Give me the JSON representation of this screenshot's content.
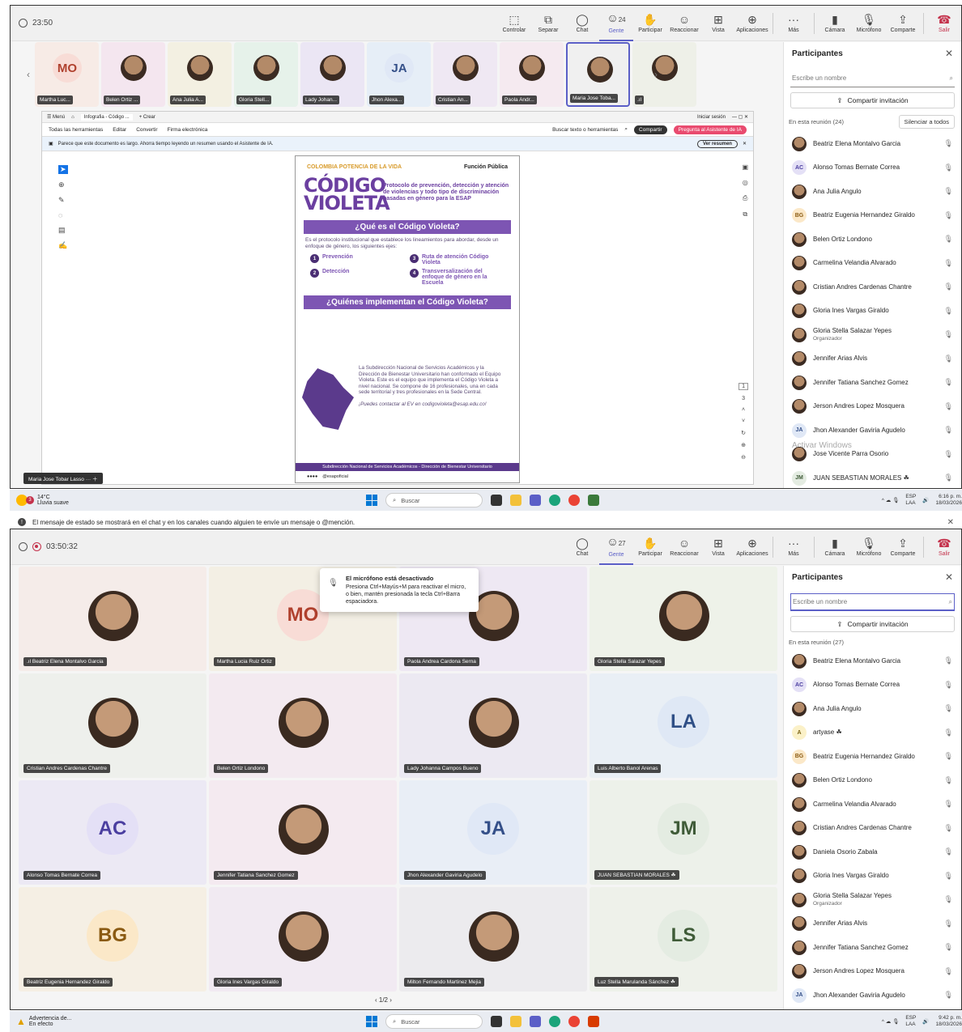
{
  "win1": {
    "timer": "23:50",
    "tools": [
      {
        "icon": "control-icon",
        "glyph": "⬚",
        "label": "Controlar"
      },
      {
        "icon": "popout-icon",
        "glyph": "⧉",
        "label": "Separar"
      },
      {
        "icon": "chat-icon",
        "glyph": "◯",
        "label": "Chat"
      },
      {
        "icon": "people-icon",
        "glyph": "☺",
        "label": "Gente",
        "count": "24"
      },
      {
        "icon": "raise-hand-icon",
        "glyph": "✋",
        "label": "Participar"
      },
      {
        "icon": "react-icon",
        "glyph": "☺",
        "label": "Reaccionar"
      },
      {
        "icon": "view-icon",
        "glyph": "⊞",
        "label": "Vista"
      },
      {
        "icon": "apps-icon",
        "glyph": "⊕",
        "label": "Aplicaciones"
      },
      {
        "icon": "more-icon",
        "glyph": "···",
        "label": "Más"
      },
      {
        "icon": "camera-icon",
        "glyph": "▮",
        "label": "Cámara"
      },
      {
        "icon": "mic-icon",
        "glyph": "🎙",
        "label": "Micrófono"
      },
      {
        "icon": "share-icon",
        "glyph": "⇪",
        "label": "Comparte"
      },
      {
        "icon": "leave-icon",
        "glyph": "☎",
        "label": "Salir"
      }
    ],
    "strip": [
      {
        "name": "Martha Luc...",
        "ini": "MO",
        "bg": "#f8dcd6",
        "fg": "#b0412e"
      },
      {
        "name": "Belen Ortiz ..."
      },
      {
        "name": "Ana Julia A..."
      },
      {
        "name": "Gloria Stell..."
      },
      {
        "name": "Lady Johan..."
      },
      {
        "name": "Jhon Alexa...",
        "ini": "JA",
        "bg": "#e0e8f6",
        "fg": "#355089"
      },
      {
        "name": "Cristian An..."
      },
      {
        "name": "Paola Andr..."
      },
      {
        "name": "Maria Jose Toba...",
        "active": true
      },
      {
        "name": ".ıl"
      }
    ],
    "pdf": {
      "tab1": "☰ Menú",
      "tab2": "Infografia - Código ...",
      "tab3": "+ Crear",
      "signin": "Iniciar sesión",
      "menu": [
        "Todas las herramientas",
        "Editar",
        "Convertir",
        "Firma electrónica"
      ],
      "search": "Buscar texto o herramientas",
      "share": "Compartir",
      "ask": "Pregunta al Asistente de IA",
      "banner": "Parece que este documento es largo. Ahorra tiempo leyendo un resumen usando el Asistente de IA.",
      "summary": "Ver resumen",
      "logo1": "COLOMBIA POTENCIA DE LA VIDA",
      "logo2": "Función Pública",
      "cv": "CÓDIGO VIOLETA",
      "protocol": "Protocolo de prevención, detección y atención de violencias y todo tipo de discriminación basadas en género para la ESAP",
      "q1": "¿Qué es el Código Violeta?",
      "p1": "Es el protocolo institucional que establece los lineamientos para abordar, desde un enfoque de género, los siguientes ejes:",
      "steps": [
        "Prevención",
        "Ruta de atención Código Violeta",
        "Detección",
        "Transversalización del enfoque de género en la Escuela"
      ],
      "q2": "¿Quiénes implementan el Código Violeta?",
      "p2": "La Subdirección Nacional de Servicios Académicos y la Dirección de Bienestar Universitario han conformado el Equipo Violeta. Este es el equipo que implementa el Código Violeta a nivel nacional. Se compone de 16 profesionales, una en cada sede territorial y tres profesionales en la Sede Central.",
      "p3": "¡Puedes contactar al EV en codigovioleta@esap.edu.co!",
      "footer": "Subdirección Nacional de Servicios Académicos - Dirección de Bienestar Universitario",
      "footer2": "@esapoficial",
      "page_num": "1",
      "page_total": "3"
    },
    "presenter": "Maria Jose Tobar Lasso",
    "panel": {
      "title": "Participantes",
      "search": "Escribe un nombre",
      "invite": "Compartir invitación",
      "meeting": "En esta reunión (24)",
      "mute": "Silenciar a todos",
      "people": [
        {
          "n": "Beatriz Elena Montalvo Garcia"
        },
        {
          "n": "Alonso Tomas Bernate Correa",
          "ini": "AC",
          "bg": "#e4e0f6",
          "fg": "#4b3fa0"
        },
        {
          "n": "Ana Julia Angulo"
        },
        {
          "n": "Beatriz Eugenia Hernandez Giraldo",
          "ini": "BG",
          "bg": "#fbe8c8",
          "fg": "#8a5a12"
        },
        {
          "n": "Belen Ortiz Londono"
        },
        {
          "n": "Carmelina Velandia Alvarado"
        },
        {
          "n": "Cristian Andres Cardenas Chantre"
        },
        {
          "n": "Gloria Ines Vargas Giraldo"
        },
        {
          "n": "Gloria Stella Salazar Yepes",
          "role": "Organizador"
        },
        {
          "n": "Jennifer Arias Alvis"
        },
        {
          "n": "Jennifer Tatiana Sanchez Gomez"
        },
        {
          "n": "Jerson Andres Lopez Mosquera"
        },
        {
          "n": "Jhon Alexander Gaviria Agudelo",
          "ini": "JA",
          "bg": "#e0e8f6",
          "fg": "#355089"
        },
        {
          "n": "Jose Vicente Parra Osorio"
        },
        {
          "n": "JUAN SEBASTIAN MORALES ☘",
          "ini": "JM",
          "bg": "#e4ece2",
          "fg": "#3f5b38"
        }
      ],
      "watermark": "Activar Windows"
    }
  },
  "taskbar1": {
    "temp": "14°C",
    "weather": "Lluvia suave",
    "search": "Buscar",
    "lang": "ESP",
    "lang2": "LAA",
    "time": "6:16 p. m.",
    "date": "18/03/2026",
    "badge": "3"
  },
  "notice": "El mensaje de estado se mostrará en el chat y en los canales cuando alguien te envíe un mensaje o @mención.",
  "win2": {
    "timer": "03:50:32",
    "tools": [
      {
        "icon": "chat-icon",
        "glyph": "◯",
        "label": "Chat"
      },
      {
        "icon": "people-icon",
        "glyph": "☺",
        "label": "Gente",
        "count": "27"
      },
      {
        "icon": "raise-hand-icon",
        "glyph": "✋",
        "label": "Participar"
      },
      {
        "icon": "react-icon",
        "glyph": "☺",
        "label": "Reaccionar"
      },
      {
        "icon": "view-icon",
        "glyph": "⊞",
        "label": "Vista"
      },
      {
        "icon": "apps-icon",
        "glyph": "⊕",
        "label": "Aplicaciones"
      },
      {
        "icon": "more-icon",
        "glyph": "···",
        "label": "Más"
      },
      {
        "icon": "camera-icon",
        "glyph": "▮",
        "label": "Cámara"
      },
      {
        "icon": "mic-icon",
        "glyph": "🎙",
        "label": "Micrófono"
      },
      {
        "icon": "share-icon",
        "glyph": "⇪",
        "label": "Comparte"
      },
      {
        "icon": "leave-icon",
        "glyph": "☎",
        "label": "Salir"
      }
    ],
    "tooltip": {
      "title": "El micrófono está desactivado",
      "body": "Presiona Ctrl+Mayús+M para reactivar el micro, o bien, mantén presionada la tecla Ctrl+Barra espaciadora."
    },
    "grid": [
      {
        "name": ".ıl Beatriz Elena Montalvo Garcia"
      },
      {
        "name": "Martha Lucia Ruiz Ortiz",
        "ini": "MO",
        "bg": "#f8dcd6",
        "fg": "#b0412e"
      },
      {
        "name": "Paola Andrea Cardona Serna"
      },
      {
        "name": "Gloria Stella Salazar Yepes"
      },
      {
        "name": "Cristian Andres Cardenas Chantre"
      },
      {
        "name": "Belen Ortiz Londono"
      },
      {
        "name": "Lady Johanna Campos Bueno"
      },
      {
        "name": "Luis Alberto Banol Arenas",
        "ini": "LA",
        "bg": "#dfe8f5",
        "fg": "#2f4f86"
      },
      {
        "name": "Alonso Tomas Bernate Correa",
        "ini": "AC",
        "bg": "#e4e0f6",
        "fg": "#4b3fa0"
      },
      {
        "name": "Jennifer Tatiana Sanchez Gomez"
      },
      {
        "name": "Jhon Alexander Gaviria Agudelo",
        "ini": "JA",
        "bg": "#e0e8f6",
        "fg": "#355089"
      },
      {
        "name": "JUAN SEBASTIAN MORALES ☘",
        "ini": "JM",
        "bg": "#e4ece2",
        "fg": "#3f5b38"
      },
      {
        "name": "Beatriz Eugenia Hernandez Giraldo",
        "ini": "BG",
        "bg": "#fbe8c8",
        "fg": "#8a5a12"
      },
      {
        "name": "Gloria Ines Vargas Giraldo"
      },
      {
        "name": "Milton Fernando Martinez Mejia"
      },
      {
        "name": "Luz Stella Marulanda Sánchez ☘",
        "ini": "LS",
        "bg": "#e4ece2",
        "fg": "#3f5b38"
      }
    ],
    "pager": "‹ 1/2 ›",
    "panel": {
      "title": "Participantes",
      "search": "Escribe un nombre",
      "invite": "Compartir invitación",
      "meeting": "En esta reunión (27)",
      "people": [
        {
          "n": "Beatriz Elena Montalvo Garcia"
        },
        {
          "n": "Alonso Tomas Bernate Correa",
          "ini": "AC",
          "bg": "#e4e0f6",
          "fg": "#4b3fa0"
        },
        {
          "n": "Ana Julia Angulo"
        },
        {
          "n": "artyase ☘",
          "ini": "A",
          "bg": "#fbf1c8",
          "fg": "#7a6212"
        },
        {
          "n": "Beatriz Eugenia Hernandez Giraldo",
          "ini": "BG",
          "bg": "#fbe8c8",
          "fg": "#8a5a12"
        },
        {
          "n": "Belen Ortiz Londono"
        },
        {
          "n": "Carmelina Velandia Alvarado"
        },
        {
          "n": "Cristian Andres Cardenas Chantre"
        },
        {
          "n": "Daniela Osorio Zabala"
        },
        {
          "n": "Gloria Ines Vargas Giraldo"
        },
        {
          "n": "Gloria Stella Salazar Yepes",
          "role": "Organizador"
        },
        {
          "n": "Jennifer Arias Alvis"
        },
        {
          "n": "Jennifer Tatiana Sanchez Gomez"
        },
        {
          "n": "Jerson Andres Lopez Mosquera"
        },
        {
          "n": "Jhon Alexander Gaviria Agudelo",
          "ini": "JA",
          "bg": "#e0e8f6",
          "fg": "#355089"
        }
      ]
    }
  },
  "taskbar2": {
    "alert": "Advertencia de...",
    "alert2": "En efecto",
    "search": "Buscar",
    "lang": "ESP",
    "lang2": "LAA",
    "time": "9:42 p. m.",
    "date": "18/03/2026"
  }
}
